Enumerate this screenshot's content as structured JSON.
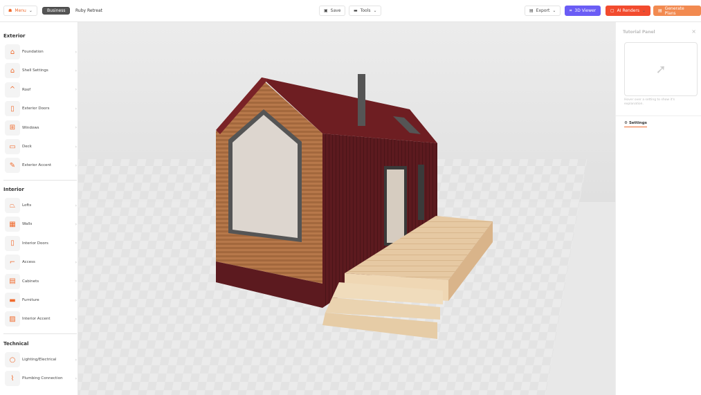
{
  "header": {
    "menu": "Menu",
    "plan_badge": "Business",
    "project_name": "Ruby Retreat",
    "save": "Save",
    "tools": "Tools",
    "export": "Export",
    "viewer_3d": "3D Viewer",
    "ai_renders": "AI Renders",
    "generate_plans": "Generate Plans"
  },
  "sidebar": {
    "sections": [
      {
        "title": "Exterior",
        "items": [
          {
            "label": "Foundation",
            "icon": "foundation-icon"
          },
          {
            "label": "Shell Settings",
            "icon": "house-icon"
          },
          {
            "label": "Roof",
            "icon": "roof-icon"
          },
          {
            "label": "Exterior Doors",
            "icon": "door-icon"
          },
          {
            "label": "Windows",
            "icon": "window-icon"
          },
          {
            "label": "Deck",
            "icon": "deck-icon"
          },
          {
            "label": "Exterior Accent",
            "icon": "palette-icon"
          }
        ]
      },
      {
        "title": "Interior",
        "items": [
          {
            "label": "Lofts",
            "icon": "loft-icon"
          },
          {
            "label": "Walls",
            "icon": "wall-icon"
          },
          {
            "label": "Interior Doors",
            "icon": "door-icon"
          },
          {
            "label": "Access",
            "icon": "stairs-icon"
          },
          {
            "label": "Cabinets",
            "icon": "cabinet-icon"
          },
          {
            "label": "Furniture",
            "icon": "sofa-icon"
          },
          {
            "label": "Interior Accent",
            "icon": "accent-icon"
          }
        ]
      },
      {
        "title": "Technical",
        "items": [
          {
            "label": "Lighting/Electrical",
            "icon": "bulb-icon"
          },
          {
            "label": "Plumbing Connection",
            "icon": "pipe-icon"
          }
        ]
      }
    ]
  },
  "tutorial": {
    "title": "Tutorial Panel",
    "hint": "Hover over a setting to show it's explanation.",
    "tab": "Settings"
  },
  "colors": {
    "accent": "#f06a2c",
    "viewer": "#6a5cf5",
    "ai": "#f24b2e",
    "generate": "#f28a50"
  }
}
